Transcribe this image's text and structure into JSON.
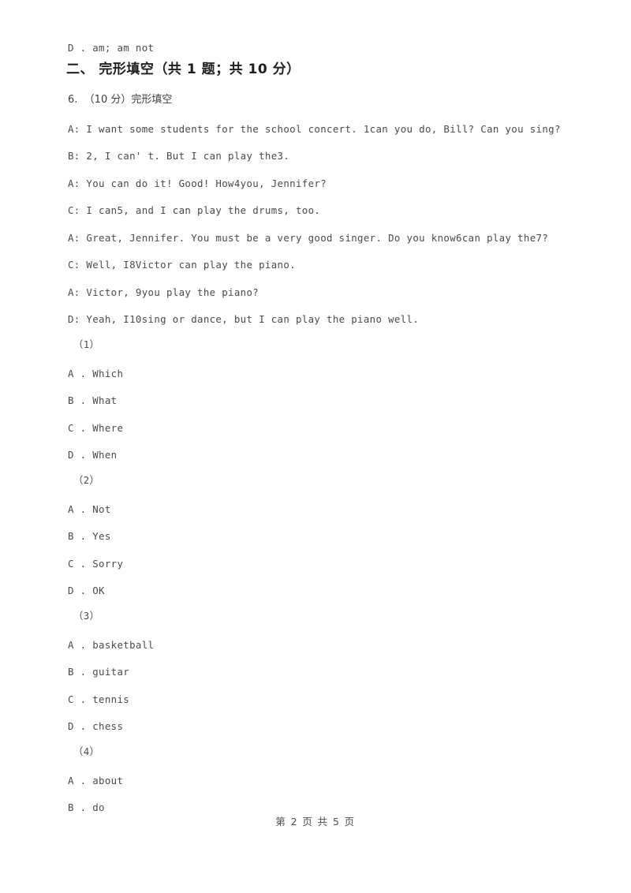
{
  "document": {
    "paper_background": "#ffffff",
    "text_color": "#4a4a4a",
    "heading_color": "#1f1f1f"
  },
  "orphan_choice": {
    "text": "D . am; am not"
  },
  "section": {
    "heading": "二、 完形填空（共 1 题；共 10 分）"
  },
  "question": {
    "number_label": "6.",
    "score_label": "（10 分）",
    "type_label": "完形填空",
    "full_line": "6.  （10 分）完形填空",
    "passage": [
      "A: I want some students for the school concert. 1can you do, Bill? Can you sing?",
      "B: 2, I can' t. But I can play the3.",
      "A: You can do it! Good! How4you, Jennifer?",
      "C: I can5, and I can play the drums, too.",
      "A: Great, Jennifer. You must be a very good singer. Do you know6can play the7?",
      "C: Well, I8Victor can play the piano.",
      "A: Victor, 9you play the piano?",
      "D: Yeah, I10sing or dance, but I can play the piano well."
    ],
    "sub_questions": [
      {
        "label": "（1）",
        "options": [
          "A . Which",
          "B . What",
          "C . Where",
          "D . When"
        ]
      },
      {
        "label": "（2）",
        "options": [
          "A . Not",
          "B . Yes",
          "C . Sorry",
          "D . OK"
        ]
      },
      {
        "label": "（3）",
        "options": [
          "A . basketball",
          "B . guitar",
          "C . tennis",
          "D . chess"
        ]
      },
      {
        "label": "（4）",
        "options": [
          "A . about",
          "B . do"
        ]
      }
    ]
  },
  "footer": {
    "text": "第 2 页 共 5 页",
    "current_page": 2,
    "total_pages": 5
  }
}
